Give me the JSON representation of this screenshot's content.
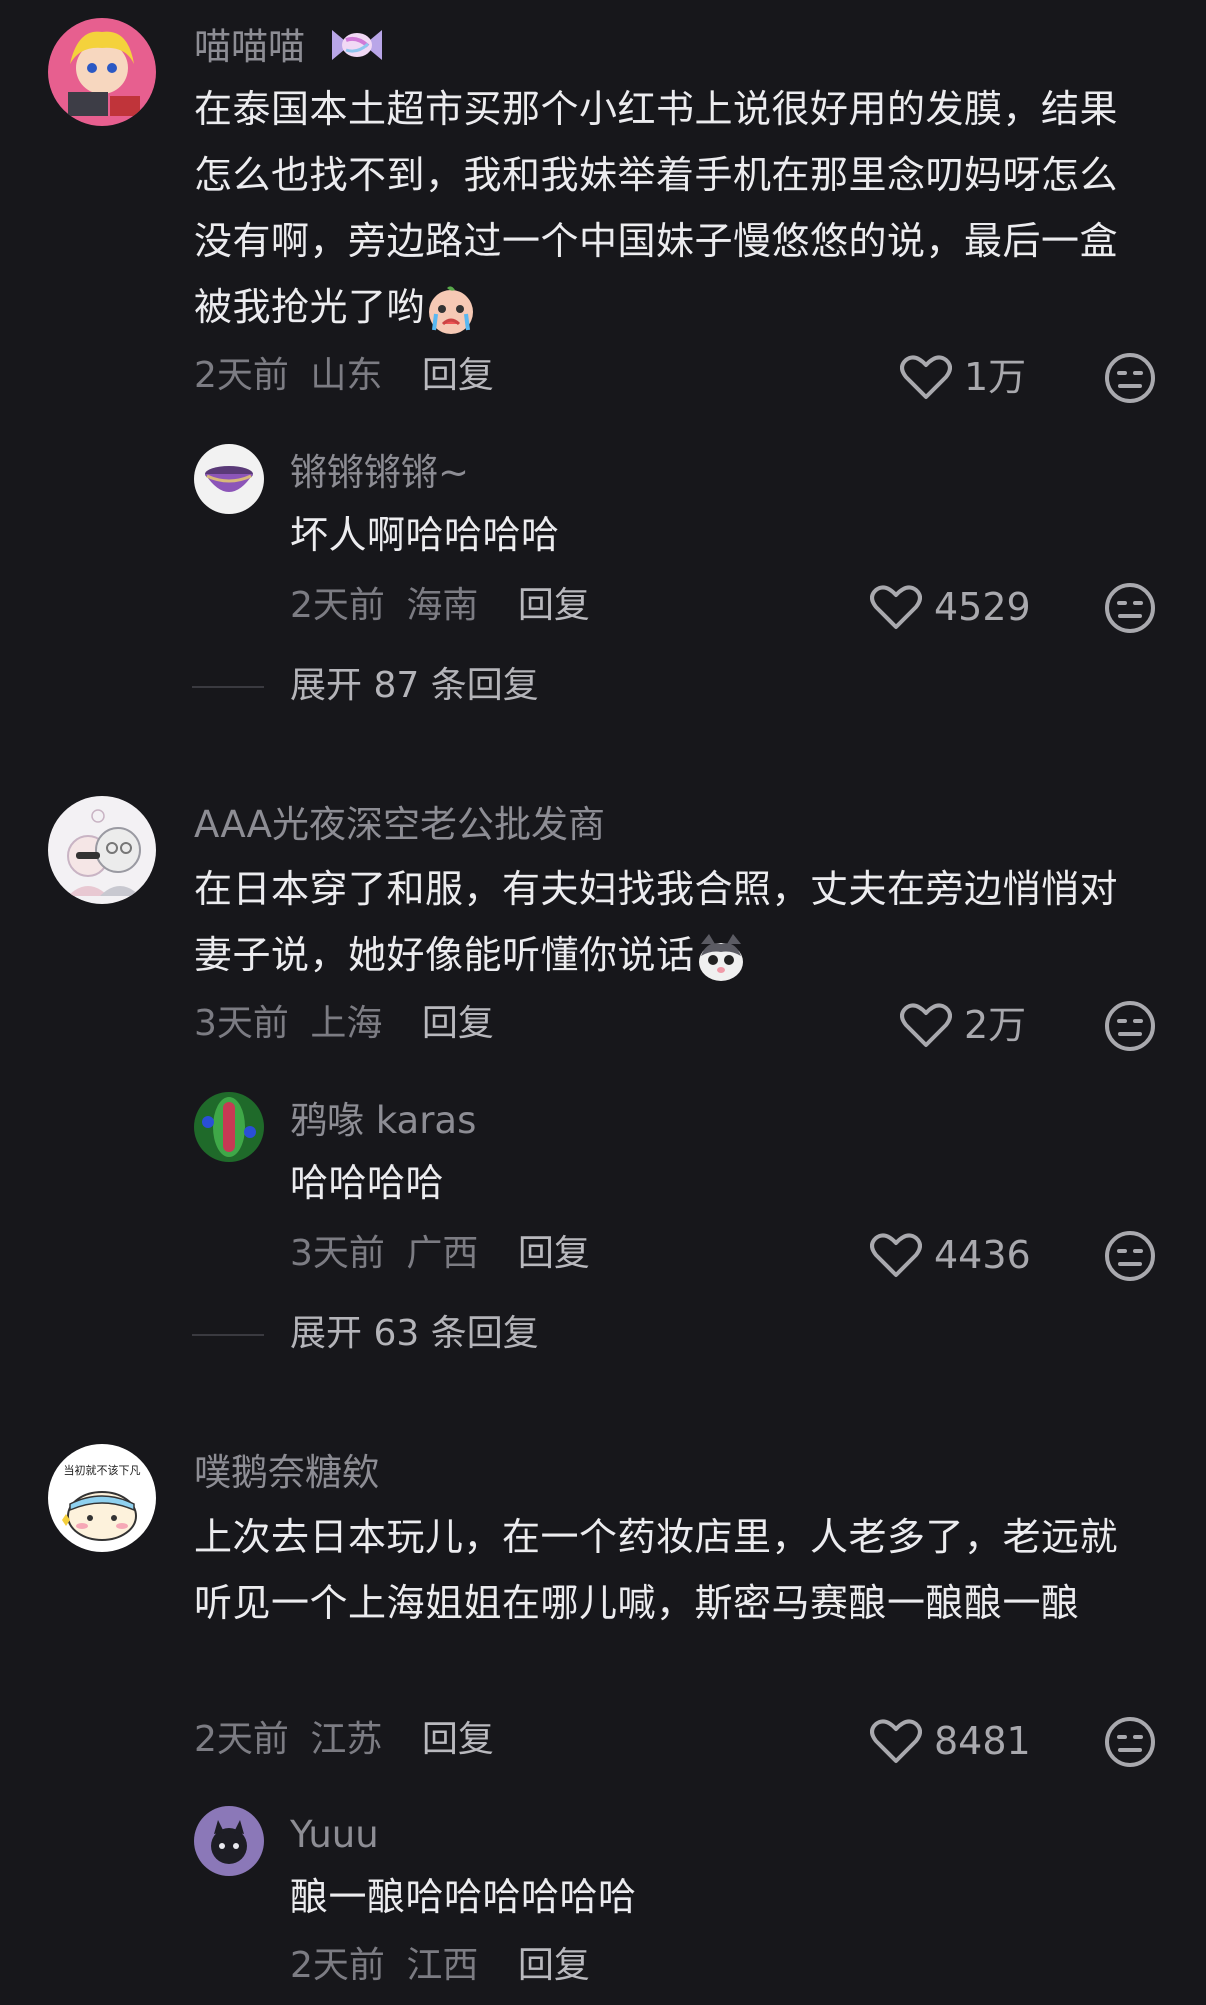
{
  "comments": [
    {
      "user": "喵喵喵",
      "text": "在泰国本土超市买那个小红书上说很好用的发膜，结果怎么也找不到，我和我妹举着手机在那里念叨妈呀怎么没有啊，旁边路过一个中国妹子慢悠悠的说，最后一盒被我抢光了哟",
      "time": "2天前",
      "location": "山东",
      "reply_label": "回复",
      "likes": "1万",
      "sub": {
        "user": "锵锵锵锵~",
        "text": "坏人啊哈哈哈哈",
        "time": "2天前",
        "location": "海南",
        "reply_label": "回复",
        "likes": "4529"
      },
      "expand_label": "展开 87 条回复"
    },
    {
      "user": "AAA光夜深空老公批发商",
      "text": "在日本穿了和服，有夫妇找我合照，丈夫在旁边悄悄对妻子说，她好像能听懂你说话",
      "time": "3天前",
      "location": "上海",
      "reply_label": "回复",
      "likes": "2万",
      "sub": {
        "user": "鸦喙 karas",
        "text": "哈哈哈哈",
        "time": "3天前",
        "location": "广西",
        "reply_label": "回复",
        "likes": "4436"
      },
      "expand_label": "展开 63 条回复"
    },
    {
      "user": "噗鹅奈糖欸",
      "text": "上次去日本玩儿，在一个药妆店里，人老多了，老远就听见一个上海姐姐在哪儿喊，斯密马赛酿一酿酿一酿",
      "time": "2天前",
      "location": "江苏",
      "reply_label": "回复",
      "likes": "8481",
      "avatar_text": "当初就不该下凡",
      "sub": {
        "user": "Yuuu",
        "text": "酿一酿哈哈哈哈哈哈",
        "time": "2天前",
        "location": "江西",
        "reply_label": "回复"
      }
    }
  ],
  "icons": {
    "like": "heart-outline-icon",
    "dislike": "meh-face-icon",
    "title_badge": "candy-icon",
    "emoji_1": "crying-face-emoji",
    "emoji_2": "cat-face-emoji"
  },
  "colors": {
    "background": "#17171b",
    "username": "#8d8d94",
    "text": "#ececef",
    "meta": "#7c7c83"
  }
}
